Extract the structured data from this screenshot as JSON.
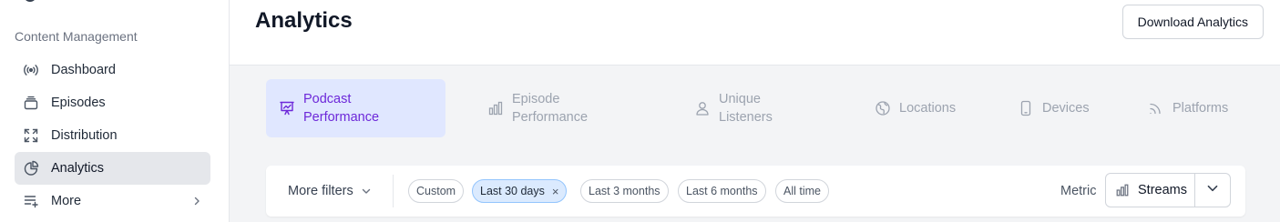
{
  "sidebar": {
    "section_label": "Content Management",
    "items": [
      {
        "label": "Dashboard",
        "icon": "broadcast-icon"
      },
      {
        "label": "Episodes",
        "icon": "stack-icon"
      },
      {
        "label": "Distribution",
        "icon": "expand-icon"
      },
      {
        "label": "Analytics",
        "icon": "pie-chart-icon",
        "active": true
      },
      {
        "label": "More",
        "icon": "list-plus-icon"
      }
    ]
  },
  "header": {
    "title": "Analytics",
    "download_label": "Download Analytics"
  },
  "tabs": [
    {
      "label": "Podcast Performance",
      "icon": "presentation-chart-icon",
      "active": true
    },
    {
      "label": "Episode Performance",
      "icon": "bar-chart-icon"
    },
    {
      "label": "Unique Listeners",
      "icon": "user-icon"
    },
    {
      "label": "Locations",
      "icon": "globe-icon"
    },
    {
      "label": "Devices",
      "icon": "phone-icon"
    },
    {
      "label": "Platforms",
      "icon": "rss-icon"
    }
  ],
  "filters": {
    "more_filters_label": "More filters",
    "date_ranges": [
      {
        "label": "Custom"
      },
      {
        "label": "Last 30 days",
        "active": true
      },
      {
        "label": "Last 3 months"
      },
      {
        "label": "Last 6 months"
      },
      {
        "label": "All time"
      }
    ],
    "clear_glyph": "×",
    "metric_label": "Metric",
    "metric_value": "Streams"
  },
  "colors": {
    "accent": "#6d28d9",
    "active_tab_bg": "#e0e7ff",
    "active_pill_bg": "#dbeafe",
    "content_bg": "#f3f4f6"
  }
}
